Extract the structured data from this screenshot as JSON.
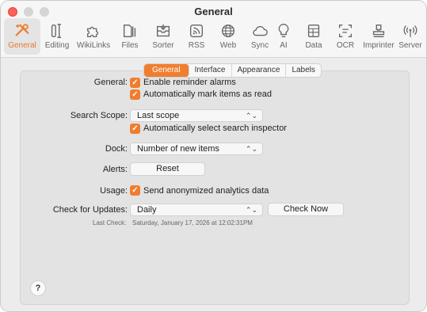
{
  "window": {
    "title": "General"
  },
  "toolbar": [
    {
      "label": "General",
      "icon": "tools-icon",
      "active": true
    },
    {
      "label": "Editing",
      "icon": "editing-icon"
    },
    {
      "label": "WikiLinks",
      "icon": "puzzle-icon"
    },
    {
      "label": "Files",
      "icon": "files-icon"
    },
    {
      "label": "Sorter",
      "icon": "sorter-tray-icon"
    },
    {
      "label": "RSS",
      "icon": "rss-icon"
    },
    {
      "label": "Web",
      "icon": "globe-icon"
    },
    {
      "label": "Sync",
      "icon": "cloud-icon"
    },
    {
      "label": "AI",
      "icon": "lightbulb-icon"
    },
    {
      "label": "Data",
      "icon": "data-grid-icon"
    },
    {
      "label": "OCR",
      "icon": "ocr-icon"
    },
    {
      "label": "Imprinter",
      "icon": "stamp-icon"
    },
    {
      "label": "Server",
      "icon": "broadcast-icon"
    }
  ],
  "tabs": [
    "General",
    "Interface",
    "Appearance",
    "Labels"
  ],
  "form": {
    "general_label": "General:",
    "enable_reminders": "Enable reminder alarms",
    "auto_mark_read": "Automatically mark items as read",
    "search_scope_label": "Search Scope:",
    "search_scope_value": "Last scope",
    "auto_select_inspector": "Automatically select search inspector",
    "dock_label": "Dock:",
    "dock_value": "Number of new items",
    "alerts_label": "Alerts:",
    "reset_button": "Reset",
    "usage_label": "Usage:",
    "usage_text": "Send anonymized analytics data",
    "check_updates_label": "Check for Updates:",
    "check_updates_value": "Daily",
    "check_now_button": "Check Now",
    "last_check_label": "Last Check:",
    "last_check_value": "Saturday, January 17, 2026 at 12:02:31PM"
  },
  "help": "?",
  "colors": {
    "accent": "#ef7e2f",
    "close": "#fe5f57"
  }
}
